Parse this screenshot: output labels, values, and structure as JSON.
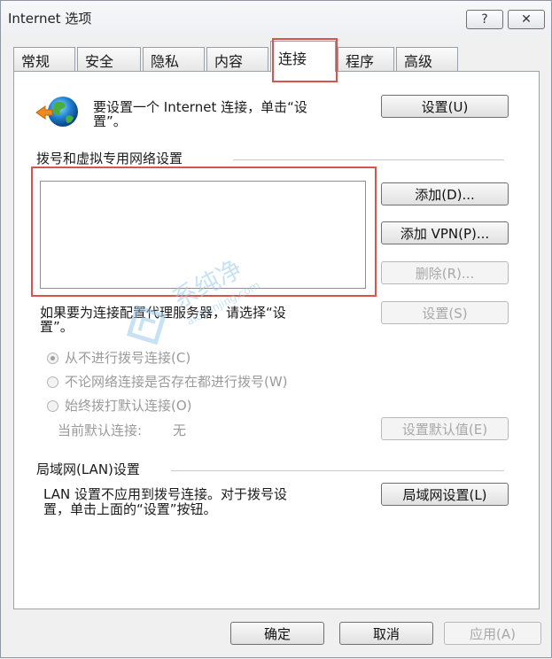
{
  "window": {
    "title": "Internet 选项",
    "help_button": "?",
    "close_button": "✕"
  },
  "tabs": [
    {
      "label": "常规"
    },
    {
      "label": "安全"
    },
    {
      "label": "隐私"
    },
    {
      "label": "内容"
    },
    {
      "label": "连接",
      "active": true
    },
    {
      "label": "程序"
    },
    {
      "label": "高级"
    }
  ],
  "setup": {
    "text_line1": "要设置一个 Internet 连接，单击“设",
    "text_line2": "置”。",
    "button": "设置(U)"
  },
  "dialup": {
    "section_title": "拨号和虚拟专用网络设置",
    "add_button": "添加(D)...",
    "add_vpn_button": "添加 VPN(P)...",
    "delete_button": "删除(R)...",
    "proxy_text_line1": "如果要为连接配置代理服务器，请选择“设",
    "proxy_text_line2": "置”。",
    "settings_button": "设置(S)",
    "radio_never": "从不进行拨号连接(C)",
    "radio_whenever": "不论网络连接是否存在都进行拨号(W)",
    "radio_always": "始终拨打默认连接(O)",
    "current_default_label": "当前默认连接:",
    "current_default_value": "无",
    "set_default_button": "设置默认值(E)"
  },
  "lan": {
    "section_title": "局域网(LAN)设置",
    "text_line1": "LAN 设置不应用到拨号连接。对于拨号设",
    "text_line2": "置，单击上面的“设置”按钮。",
    "button": "局域网设置(L)"
  },
  "footer": {
    "ok": "确定",
    "cancel": "取消",
    "apply": "应用(A)"
  },
  "watermark": {
    "text": "系纯净",
    "url": "aichunjing.com"
  },
  "colors": {
    "highlight": "#d9534f",
    "watermark": "#9ccbea"
  }
}
